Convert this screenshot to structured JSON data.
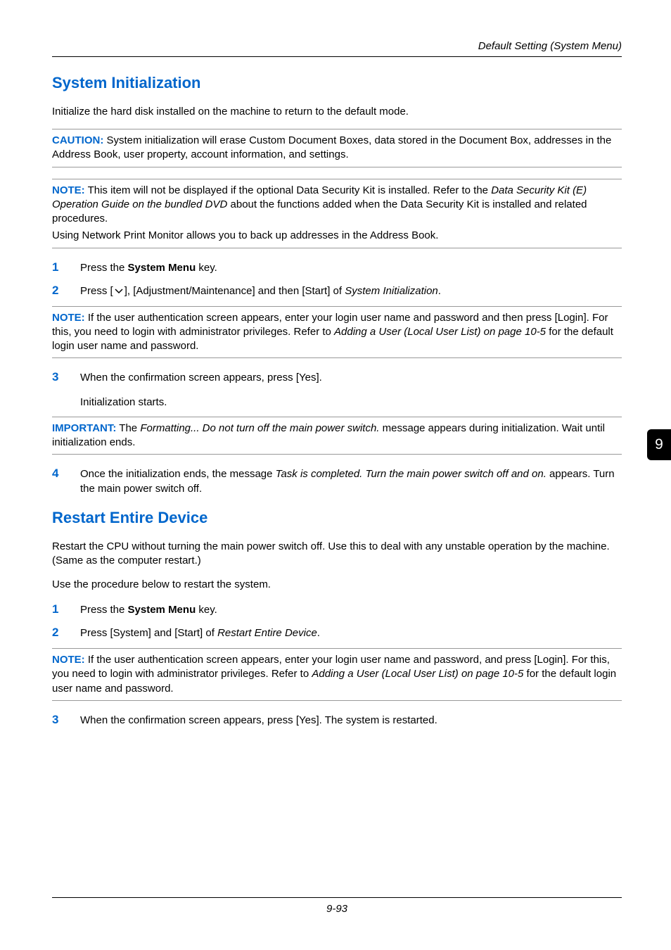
{
  "running_head": "Default Setting (System Menu)",
  "side_tab": "9",
  "footer": "9-93",
  "section1": {
    "heading": "System Initialization",
    "intro": "Initialize the hard disk installed on the machine to return to the default mode.",
    "caution_label": "CAUTION:",
    "caution_body": " System initialization will erase Custom Document Boxes, data stored in the Document Box, addresses in the Address Book, user property, account information, and settings.",
    "note1_label": "NOTE:",
    "note1_line1a": " This item will not be displayed if the optional Data Security Kit is installed. Refer to the ",
    "note1_line1b": "Data Security Kit (E) Operation Guide on the bundled DVD",
    "note1_line1c": " about the functions added when the Data Security Kit is installed and related procedures.",
    "note1_line2": "Using Network Print Monitor allows you to back up addresses in the Address Book.",
    "step1_a": "Press the ",
    "step1_b": "System Menu",
    "step1_c": " key.",
    "step2_a": "Press [",
    "step2_b": "], [Adjustment/Maintenance] and then [Start] of ",
    "step2_c": "System Initialization",
    "step2_d": ".",
    "note2_label": "NOTE:",
    "note2_a": " If the user authentication screen appears, enter your login user name and password and then press [Login]. For this, you need to login with administrator privileges. Refer to ",
    "note2_b": "Adding a User (Local User List) on page 10-5",
    "note2_c": " for the default login user name and password.",
    "step3_a": "When the confirmation screen appears, press [Yes].",
    "step3_b": "Initialization starts.",
    "important_label": "IMPORTANT:",
    "important_a": " The ",
    "important_b": "Formatting... Do not turn off the main power switch.",
    "important_c": " message appears during initialization. Wait until initialization ends.",
    "step4_a": "Once the initialization ends, the message ",
    "step4_b": "Task is completed. Turn the main power switch off and on.",
    "step4_c": " appears. Turn the main power switch off."
  },
  "section2": {
    "heading": "Restart Entire Device",
    "intro1": "Restart the CPU without turning the main power switch off. Use this to deal with any unstable operation by the machine. (Same as the computer restart.)",
    "intro2": "Use the procedure below to restart the system.",
    "step1_a": "Press the ",
    "step1_b": "System Menu",
    "step1_c": " key.",
    "step2_a": "Press [System] and [Start] of ",
    "step2_b": "Restart Entire Device",
    "step2_c": ".",
    "note_label": "NOTE:",
    "note_a": " If the user authentication screen appears, enter your login user name and password, and press [Login]. For this, you need to login with administrator privileges. Refer to ",
    "note_b": "Adding a User (Local User List) on page 10-5",
    "note_c": " for the default login user name and password.",
    "step3": "When the confirmation screen appears, press [Yes]. The system is restarted."
  }
}
